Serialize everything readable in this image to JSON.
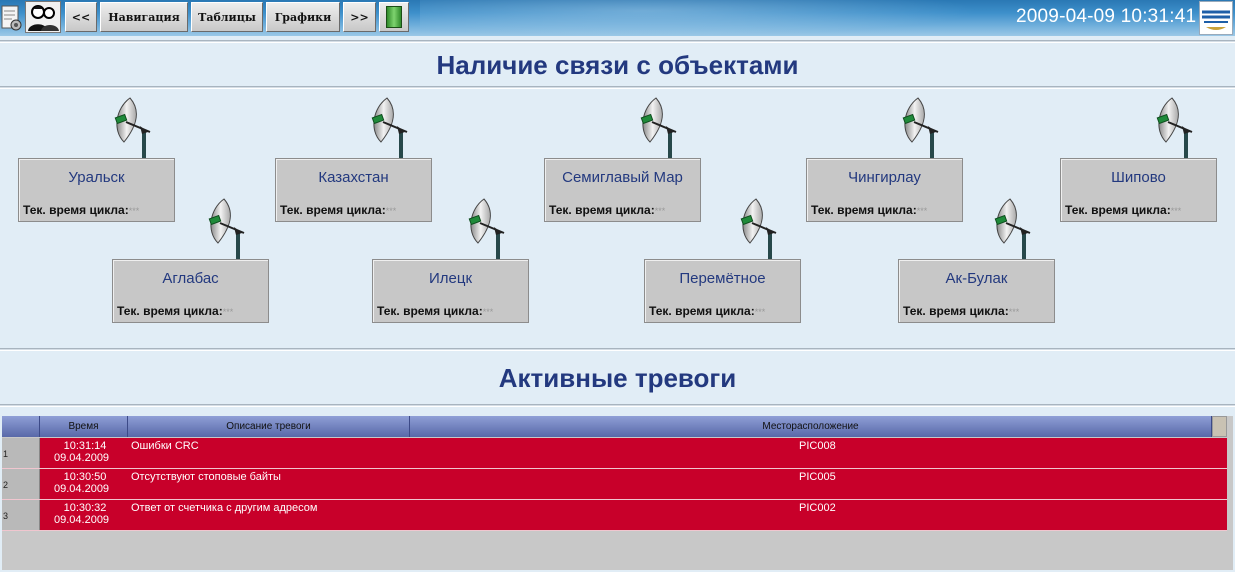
{
  "toolbar": {
    "prev_label": "<<",
    "nav_label": "Навигация",
    "tables_label": "Таблицы",
    "charts_label": "Графики",
    "next_label": ">>",
    "datetime": "2009-04-09 10:31:41"
  },
  "connectivity": {
    "title": "Наличие связи с объектами",
    "cycle_label": "Тек. время цикла:",
    "cycle_value": "***",
    "stations": [
      {
        "name": "Уральск"
      },
      {
        "name": "Казахстан"
      },
      {
        "name": "Семиглавый Мар"
      },
      {
        "name": "Чингирлау"
      },
      {
        "name": "Шипово"
      },
      {
        "name": "Аглабас"
      },
      {
        "name": "Илецк"
      },
      {
        "name": "Перемётное"
      },
      {
        "name": "Ак-Булак"
      }
    ]
  },
  "alarms": {
    "title": "Активные тревоги",
    "columns": {
      "time": "Время",
      "description": "Описание тревоги",
      "location": "Месторасположение"
    },
    "rows": [
      {
        "index": "1",
        "time": "10:31:14",
        "date": "09.04.2009",
        "description": "Ошибки CRC",
        "location": "PIC008"
      },
      {
        "index": "2",
        "time": "10:30:50",
        "date": "09.04.2009",
        "description": "Отсутствуют стоповые байты",
        "location": "PIC005"
      },
      {
        "index": "3",
        "time": "10:30:32",
        "date": "09.04.2009",
        "description": "Ответ от счетчика с другим адресом",
        "location": "PIC002"
      }
    ],
    "row_color": "#c8002a"
  }
}
